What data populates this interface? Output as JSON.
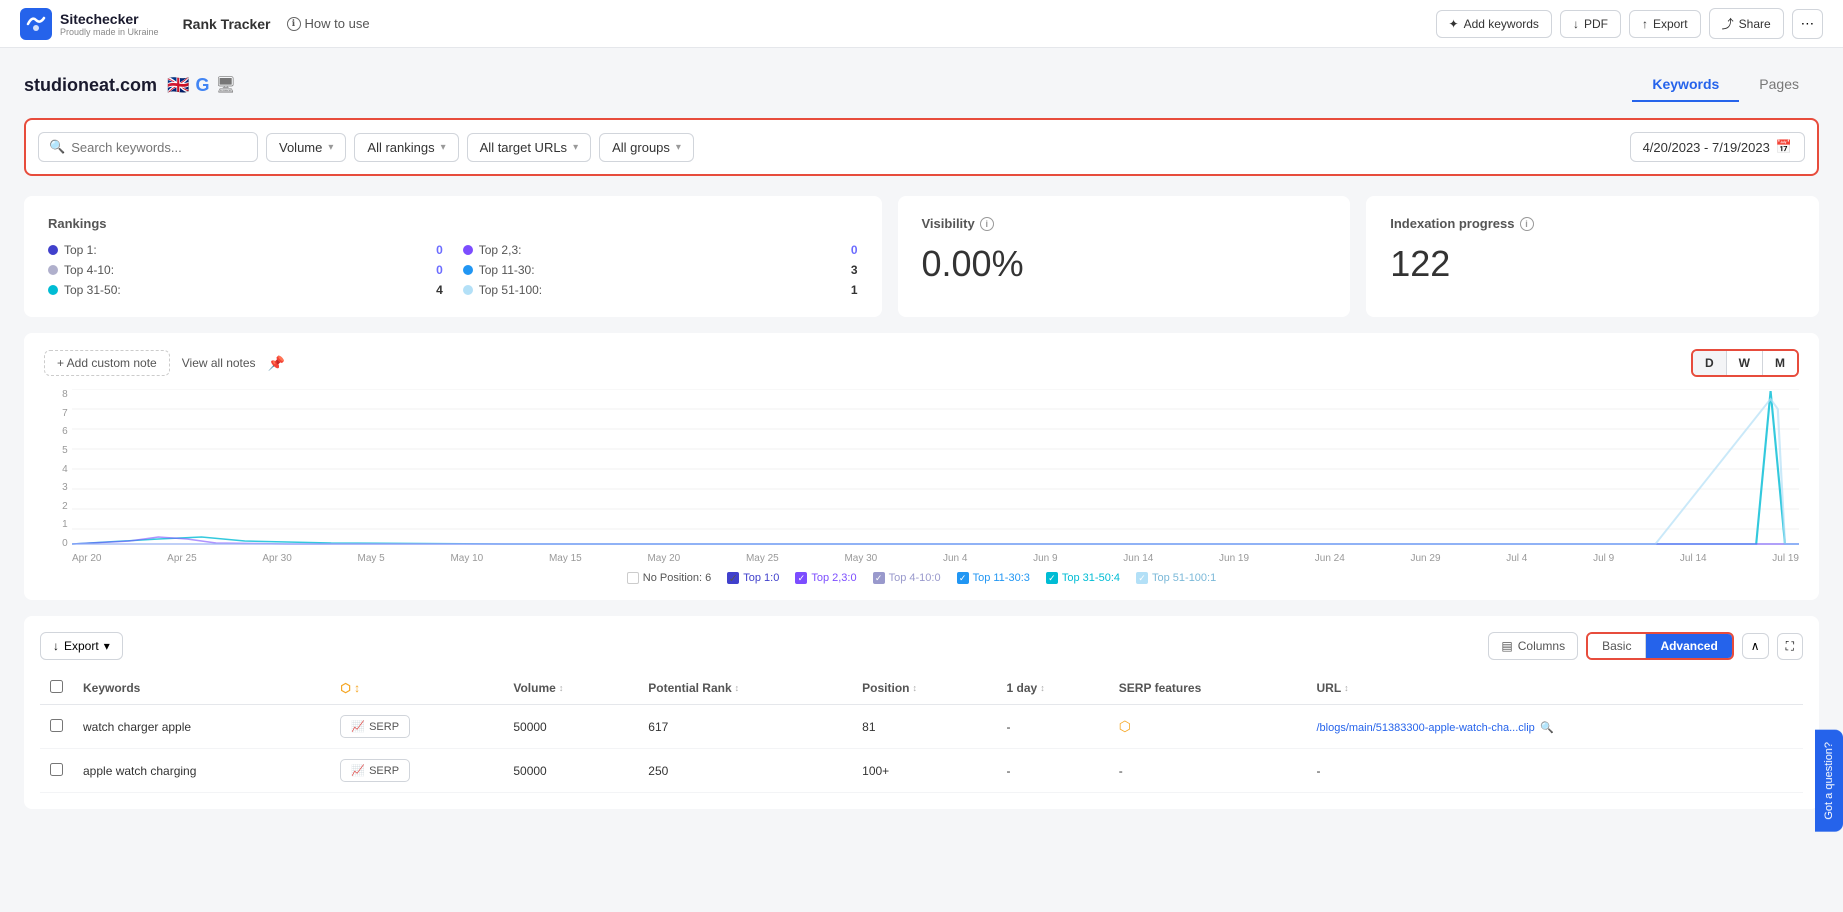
{
  "logo": {
    "title": "Sitechecker",
    "subtitle": "Proudly made in Ukraine",
    "icon_color": "#2563eb"
  },
  "nav": {
    "app_title": "Rank Tracker",
    "how_to_use": "How to use",
    "add_keywords_btn": "Add keywords",
    "pdf_btn": "PDF",
    "export_btn": "Export",
    "share_btn": "Share"
  },
  "site": {
    "domain": "studioneat.com",
    "tabs": [
      "Keywords",
      "Pages"
    ],
    "active_tab": "Keywords"
  },
  "filters": {
    "search_placeholder": "Search keywords...",
    "volume_label": "Volume",
    "rankings_label": "All rankings",
    "urls_label": "All target URLs",
    "groups_label": "All groups",
    "date_range": "4/20/2023 - 7/19/2023"
  },
  "rankings": {
    "title": "Rankings",
    "items": [
      {
        "label": "Top 1:",
        "value": "0",
        "color": "#6c6cff",
        "dot_color": "#4040cc"
      },
      {
        "label": "Top 4-10:",
        "value": "0",
        "color": "#aaa",
        "dot_color": "#9999cc"
      },
      {
        "label": "Top 31-50:",
        "value": "4",
        "color": "#333",
        "dot_color": "#00bcd4"
      },
      {
        "label": "Top 2,3:",
        "value": "0",
        "color": "#6c6cff",
        "dot_color": "#7c4dff"
      },
      {
        "label": "Top 11-30:",
        "value": "3",
        "color": "#333",
        "dot_color": "#2196f3"
      },
      {
        "label": "Top 51-100:",
        "value": "1",
        "color": "#333",
        "dot_color": "#b3e0f7"
      }
    ]
  },
  "visibility": {
    "title": "Visibility",
    "value": "0.00%"
  },
  "indexation": {
    "title": "Indexation progress",
    "value": "122"
  },
  "chart": {
    "add_note_label": "+ Add custom note",
    "view_notes_label": "View all notes",
    "period_buttons": [
      "D",
      "W",
      "M"
    ],
    "active_period": "D",
    "x_labels": [
      "Apr 20",
      "Apr 25",
      "Apr 30",
      "May 5",
      "May 10",
      "May 15",
      "May 20",
      "May 25",
      "May 30",
      "Jun 4",
      "Jun 9",
      "Jun 14",
      "Jun 19",
      "Jun 24",
      "Jun 29",
      "Jul 4",
      "Jul 9",
      "Jul 14",
      "Jul 19"
    ],
    "y_labels": [
      "8",
      "7",
      "6",
      "5",
      "4",
      "3",
      "2",
      "1",
      "0"
    ],
    "legend": [
      {
        "label": "No Position: 6",
        "color": "#e5e7eb",
        "checked": false
      },
      {
        "label": "Top 1:0",
        "color": "#4040cc",
        "checked": true
      },
      {
        "label": "Top 2,3:0",
        "color": "#7c4dff",
        "checked": true
      },
      {
        "label": "Top 4-10:0",
        "color": "#9999cc",
        "checked": true
      },
      {
        "label": "Top 11-30:3",
        "color": "#2196f3",
        "checked": true
      },
      {
        "label": "Top 31-50:4",
        "color": "#00bcd4",
        "checked": true
      },
      {
        "label": "Top 51-100:1",
        "color": "#b3e0f7",
        "checked": true
      }
    ]
  },
  "table": {
    "export_label": "Export",
    "columns_label": "Columns",
    "view_basic": "Basic",
    "view_advanced": "Advanced",
    "headers": [
      "Keywords",
      "",
      "Volume",
      "Potential Rank",
      "Position",
      "1 day",
      "SERP features",
      "URL"
    ],
    "rows": [
      {
        "keyword": "watch charger apple",
        "volume": "50000",
        "potential_rank": "617",
        "position": "81",
        "one_day": "-",
        "serp": "SERP",
        "url": "/blogs/main/51383300-apple-watch-cha...clip",
        "has_link": true
      },
      {
        "keyword": "apple watch charging",
        "volume": "50000",
        "potential_rank": "250",
        "position": "100+",
        "one_day": "-",
        "serp": "SERP",
        "url": "-",
        "has_link": false
      }
    ]
  },
  "help_bubble": "Got a question?"
}
